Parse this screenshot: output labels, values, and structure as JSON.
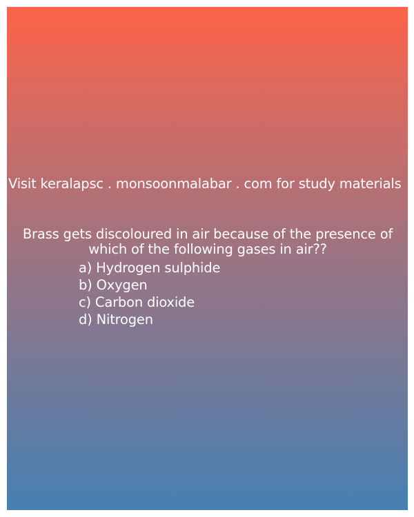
{
  "site_text": "Visit keralapsc . monsoonmalabar . com for study materials",
  "question": "Brass gets discoloured in air because of the presence of which of the following gases in air??",
  "options": [
    "a) Hydrogen sulphide",
    "b) Oxygen",
    "c) Carbon dioxide",
    "d) Nitrogen"
  ],
  "colors": {
    "gradient_top": "#fe634a",
    "gradient_bottom": "#4680b3",
    "text": "#ffffff"
  }
}
